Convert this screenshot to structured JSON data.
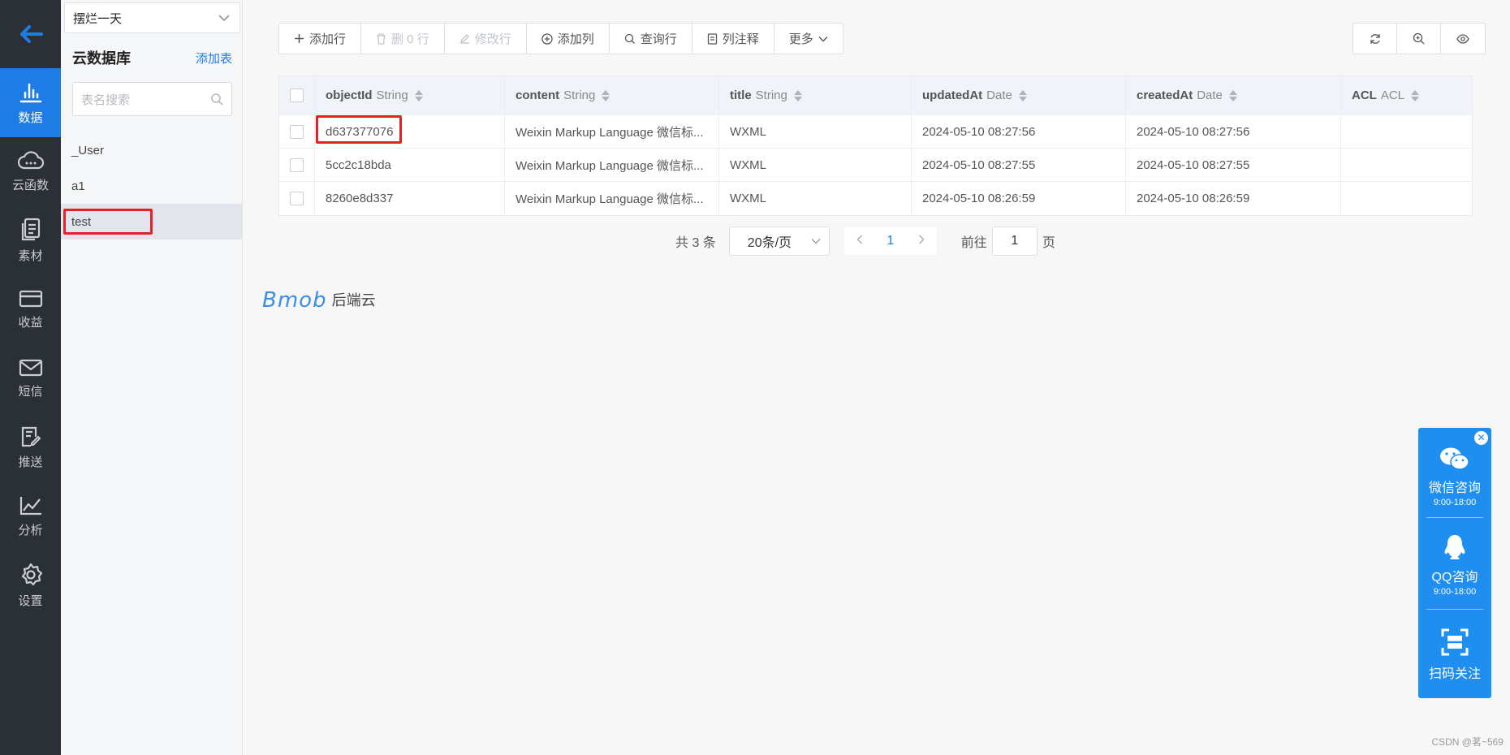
{
  "nav": {
    "items": [
      {
        "label": "数据",
        "icon": "bar-chart-icon",
        "active": true
      },
      {
        "label": "云函数",
        "icon": "cloud-icon"
      },
      {
        "label": "素材",
        "icon": "document-icon"
      },
      {
        "label": "收益",
        "icon": "card-icon"
      },
      {
        "label": "短信",
        "icon": "mail-icon"
      },
      {
        "label": "推送",
        "icon": "push-icon"
      },
      {
        "label": "分析",
        "icon": "line-chart-icon"
      },
      {
        "label": "设置",
        "icon": "gear-icon"
      }
    ]
  },
  "panel": {
    "project": "摆烂一天",
    "title": "云数据库",
    "add_table": "添加表",
    "search_placeholder": "表名搜索",
    "tables": [
      "_User",
      "a1",
      "test"
    ],
    "active_table": "test"
  },
  "toolbar": {
    "add_row": "添加行",
    "delete_rows": "删 0 行",
    "edit_row": "修改行",
    "add_column": "添加列",
    "query_row": "查询行",
    "column_comment": "列注释",
    "more": "更多"
  },
  "grid": {
    "columns": [
      {
        "name": "objectId",
        "type": "String"
      },
      {
        "name": "content",
        "type": "String"
      },
      {
        "name": "title",
        "type": "String"
      },
      {
        "name": "updatedAt",
        "type": "Date"
      },
      {
        "name": "createdAt",
        "type": "Date"
      },
      {
        "name": "ACL",
        "type": "ACL"
      }
    ],
    "rows": [
      [
        "d637377076",
        "Weixin Markup Language 微信标...",
        "WXML",
        "2024-05-10 08:27:56",
        "2024-05-10 08:27:56",
        ""
      ],
      [
        "5cc2c18bda",
        "Weixin Markup Language 微信标...",
        "WXML",
        "2024-05-10 08:27:55",
        "2024-05-10 08:27:55",
        ""
      ],
      [
        "8260e8d337",
        "Weixin Markup Language 微信标...",
        "WXML",
        "2024-05-10 08:26:59",
        "2024-05-10 08:26:59",
        ""
      ]
    ]
  },
  "pager": {
    "total": "共 3 条",
    "page_size": "20条/页",
    "current": "1",
    "goto_prefix": "前往",
    "goto_value": "1",
    "goto_suffix": "页"
  },
  "brand": {
    "logo": "Bmob",
    "text": "后端云"
  },
  "contact": {
    "wechat_title": "微信咨询",
    "wechat_hours": "9:00-18:00",
    "qq_title": "QQ咨询",
    "qq_hours": "9:00-18:00",
    "scan_title": "扫码关注"
  },
  "watermark": "CSDN @茗~569",
  "colors": {
    "accent": "#1e7ce6",
    "nav_bg": "#2b2f36",
    "highlight": "#e32323",
    "contact_bg": "#1e8ef0"
  }
}
